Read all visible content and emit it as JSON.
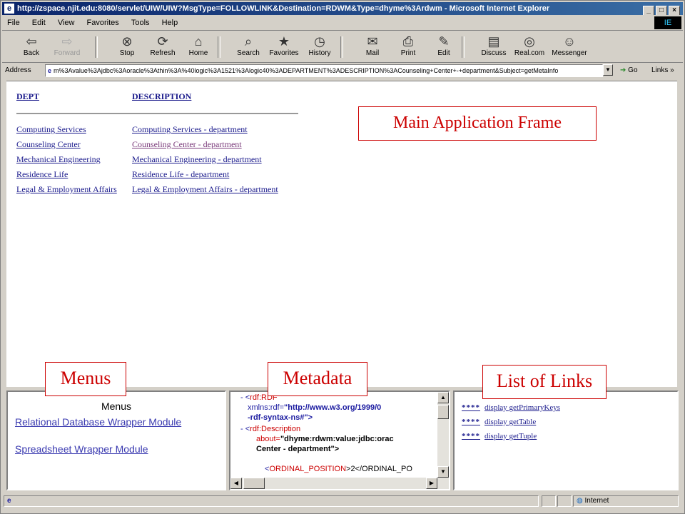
{
  "window": {
    "title": "http://zspace.njit.edu:8080/servlet/UIW/UIW?MsgType=FOLLOWLINK&Destination=RDWM&Type=dhyme%3Ardwm - Microsoft Internet Explorer",
    "ie_icon": "e",
    "logo": "IE"
  },
  "menubar": [
    "File",
    "Edit",
    "View",
    "Favorites",
    "Tools",
    "Help"
  ],
  "toolbar": [
    {
      "label": "Back",
      "icon": "⇦",
      "disabled": false
    },
    {
      "label": "Forward",
      "icon": "⇨",
      "disabled": true
    },
    {
      "label": "Stop",
      "icon": "⊗",
      "disabled": false
    },
    {
      "label": "Refresh",
      "icon": "⟳",
      "disabled": false
    },
    {
      "label": "Home",
      "icon": "⌂",
      "disabled": false
    },
    {
      "label": "Search",
      "icon": "⌕",
      "disabled": false
    },
    {
      "label": "Favorites",
      "icon": "★",
      "disabled": false
    },
    {
      "label": "History",
      "icon": "◷",
      "disabled": false
    },
    {
      "label": "Mail",
      "icon": "✉",
      "disabled": false
    },
    {
      "label": "Print",
      "icon": "⎙",
      "disabled": false
    },
    {
      "label": "Edit",
      "icon": "✎",
      "disabled": false
    },
    {
      "label": "Discuss",
      "icon": "▤",
      "disabled": false
    },
    {
      "label": "Real.com",
      "icon": "◎",
      "disabled": false
    },
    {
      "label": "Messenger",
      "icon": "☺",
      "disabled": false
    }
  ],
  "address": {
    "label": "Address",
    "value": "m%3Avalue%3Ajdbc%3Aoracle%3Athin%3A%40logic%3A1521%3Alogic40%3ADEPARTMENT%3ADESCRIPTION%3ACounseling+Center+-+department&Subject=getMetaInfo",
    "go": "Go",
    "links": "Links »"
  },
  "main": {
    "headers": {
      "dept": "DEPT",
      "description": "DESCRIPTION"
    },
    "rows": [
      {
        "dept": "Computing Services",
        "description": "Computing Services - department",
        "visited": false
      },
      {
        "dept": "Counseling Center",
        "description": "Counseling Center - department",
        "visited": true
      },
      {
        "dept": "Mechanical Engineering",
        "description": "Mechanical Engineering - department",
        "visited": false
      },
      {
        "dept": "Residence Life",
        "description": "Residence Life - department",
        "visited": false
      },
      {
        "dept": "Legal & Employment Affairs",
        "description": "Legal & Employment Affairs - department",
        "visited": false
      }
    ]
  },
  "callouts": {
    "main": "Main Application Frame",
    "menus": "Menus",
    "metadata": "Metadata",
    "links": "List of Links"
  },
  "menus_frame": {
    "title": "Menus",
    "links": [
      "Relational Database Wrapper Module",
      "Spreadsheet Wrapper Module"
    ]
  },
  "metadata_frame": {
    "lines": [
      {
        "pre": "- <",
        "tag": "rdf:RDF",
        "rest": ""
      },
      {
        "pre": "xmlns:rdf=",
        "tag": "",
        "rest": "\"http://www.w3.org/1999/0"
      },
      {
        "pre": "",
        "tag": "",
        "rest": "-rdf-syntax-ns#\">"
      },
      {
        "pre": "- <",
        "tag": "rdf:Description",
        "rest": ""
      },
      {
        "pre": "about=",
        "tag": "",
        "rest": "\"dhyme:rdwm:value:jdbc:orac"
      },
      {
        "pre": "",
        "tag": "",
        "rest": "Center - department\">"
      },
      {
        "pre": "<",
        "tag": "ORDINAL_POSITION",
        "rest": ">2</ORDINAL_PO"
      }
    ]
  },
  "links_frame": {
    "stars": "****",
    "items": [
      "display getPrimaryKeys",
      "display getTable",
      "display getTuple"
    ]
  },
  "status": {
    "zone": "Internet"
  }
}
